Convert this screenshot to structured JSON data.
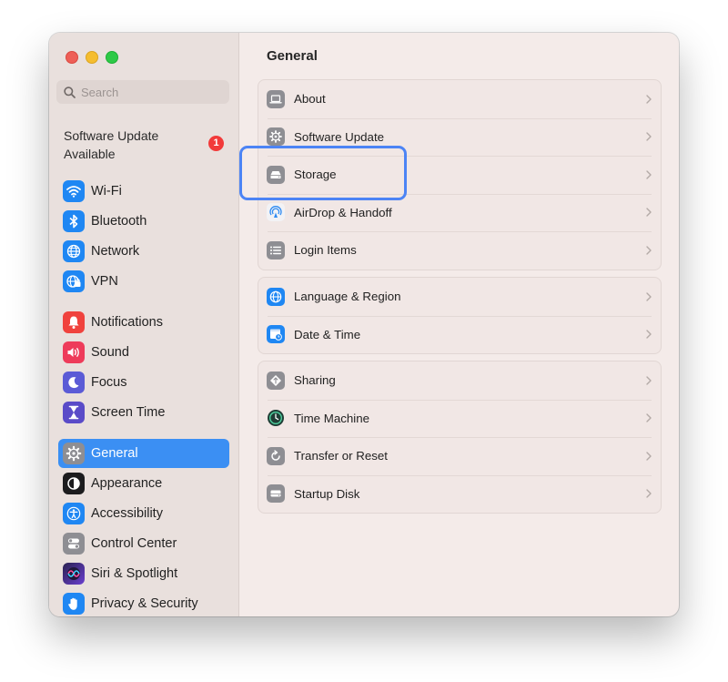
{
  "window": {
    "traffic_lights": [
      "close",
      "minimize",
      "zoom"
    ]
  },
  "sidebar": {
    "search": {
      "placeholder": "Search",
      "value": ""
    },
    "update_notice": {
      "text": "Software Update Available",
      "badge": "1"
    },
    "items": [
      {
        "label": "Wi-Fi",
        "icon": "wifi-icon",
        "color": "#1f87f3"
      },
      {
        "label": "Bluetooth",
        "icon": "bluetooth-icon",
        "color": "#1f87f3"
      },
      {
        "label": "Network",
        "icon": "globe-icon",
        "color": "#1f87f3"
      },
      {
        "label": "VPN",
        "icon": "vpn-globe-icon",
        "color": "#1f87f3"
      },
      {
        "label": "Notifications",
        "icon": "bell-icon",
        "color": "#f0423d"
      },
      {
        "label": "Sound",
        "icon": "speaker-icon",
        "color": "#ee3b5a"
      },
      {
        "label": "Focus",
        "icon": "moon-icon",
        "color": "#5b5bd6"
      },
      {
        "label": "Screen Time",
        "icon": "hourglass-icon",
        "color": "#5a4bc8"
      },
      {
        "label": "General",
        "icon": "gear-icon",
        "color": "#8e8e93",
        "active": true
      },
      {
        "label": "Appearance",
        "icon": "appearance-icon",
        "color": "#1c1c1e"
      },
      {
        "label": "Accessibility",
        "icon": "accessibility-icon",
        "color": "#1f87f3"
      },
      {
        "label": "Control Center",
        "icon": "toggles-icon",
        "color": "#8e8e93"
      },
      {
        "label": "Siri & Spotlight",
        "icon": "siri-icon",
        "color": "#6a3fd0"
      },
      {
        "label": "Privacy & Security",
        "icon": "hand-icon",
        "color": "#1f87f3"
      }
    ]
  },
  "main": {
    "title": "General",
    "groups": [
      [
        {
          "label": "About",
          "icon": "laptop-icon"
        },
        {
          "label": "Software Update",
          "icon": "gear-badge-icon"
        },
        {
          "label": "Storage",
          "icon": "drive-icon"
        },
        {
          "label": "AirDrop & Handoff",
          "icon": "airdrop-icon"
        },
        {
          "label": "Login Items",
          "icon": "list-icon"
        }
      ],
      [
        {
          "label": "Language & Region",
          "icon": "globe-icon"
        },
        {
          "label": "Date & Time",
          "icon": "calendar-clock-icon"
        }
      ],
      [
        {
          "label": "Sharing",
          "icon": "sharing-icon"
        },
        {
          "label": "Time Machine",
          "icon": "time-machine-icon"
        },
        {
          "label": "Transfer or Reset",
          "icon": "reset-icon"
        },
        {
          "label": "Startup Disk",
          "icon": "disk-icon"
        }
      ]
    ]
  },
  "colors": {
    "accent": "#3b8ff3",
    "highlight_box": "#4c84f5",
    "badge": "#f23a3a"
  }
}
